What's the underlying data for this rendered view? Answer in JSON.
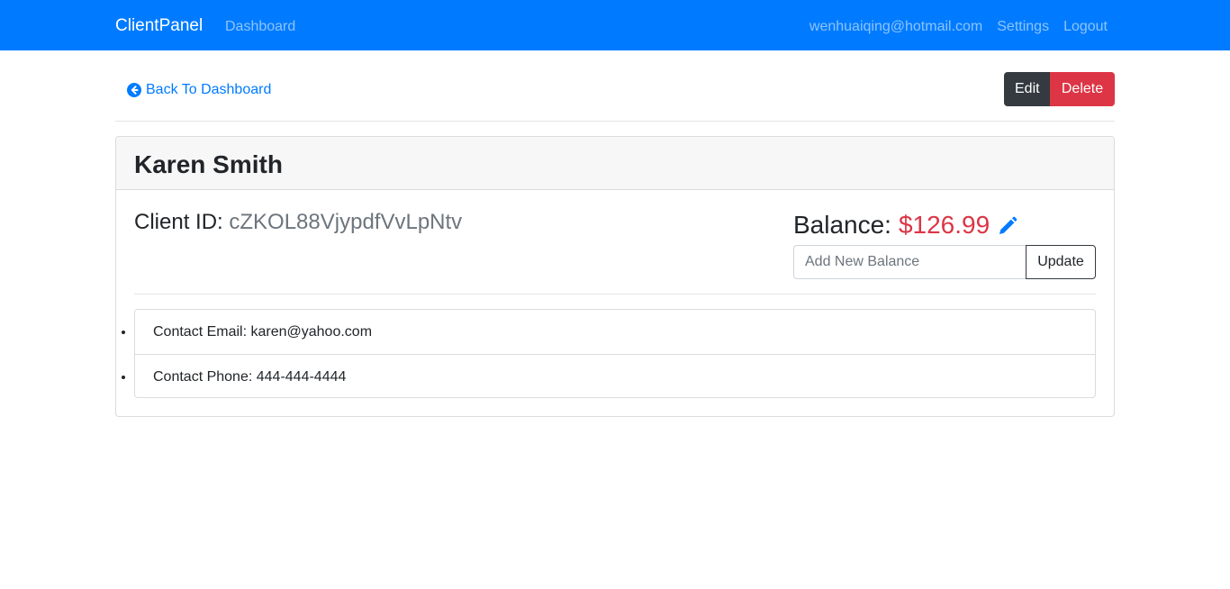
{
  "navbar": {
    "brand": "ClientPanel",
    "dashboard_link": "Dashboard",
    "user_email": "wenhuaiqing@hotmail.com",
    "settings_link": "Settings",
    "logout_link": "Logout",
    "bg_color": "#007bff"
  },
  "actions": {
    "back_label": "Back To Dashboard",
    "edit_label": "Edit",
    "delete_label": "Delete"
  },
  "client": {
    "name": "Karen Smith",
    "id_label": "Client ID:",
    "id_value": "cZKOL88VjypdfVvLpNtv",
    "balance_label": "Balance:",
    "balance_value": "$126.99",
    "balance_input_placeholder": "Add New Balance",
    "update_label": "Update",
    "contact_email": "Contact Email: karen@yahoo.com",
    "contact_phone": "Contact Phone: 444-444-4444"
  },
  "colors": {
    "primary": "#007bff",
    "danger": "#dc3545",
    "dark": "#343a40",
    "muted": "#6c757d"
  },
  "icons": {
    "back": "arrow-circle-left-icon",
    "edit_balance": "pencil-icon"
  }
}
